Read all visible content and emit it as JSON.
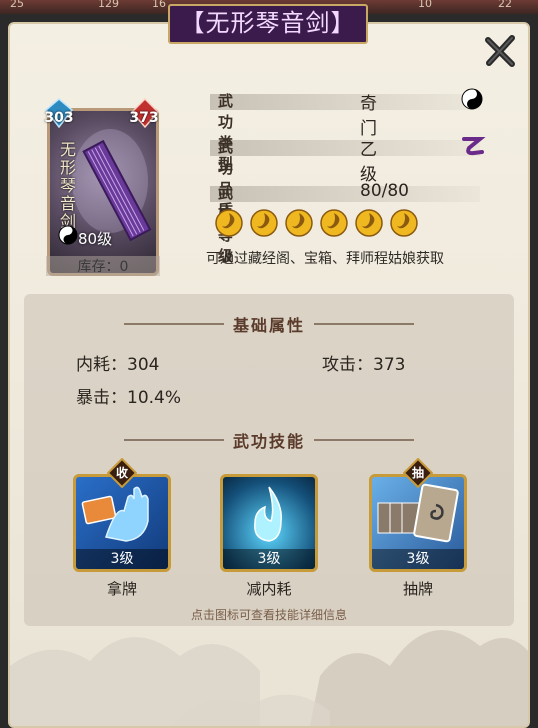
{
  "top_strip": {
    "numbers": [
      "25",
      "129",
      "16",
      "10",
      "22"
    ]
  },
  "title": "【无形琴音剑】",
  "card": {
    "name_vertical": "无形琴音剑",
    "left_gem_value": "303",
    "right_gem_value": "373",
    "level": "80级",
    "stock": "库存：0"
  },
  "info": {
    "type_label": "武功类型",
    "type_value": "奇门",
    "quality_label": "武功品质",
    "quality_value": "乙级",
    "level_label": "武功等级",
    "level_value": "80/80",
    "stars_filled": 6,
    "source": "可通过藏经阁、宝箱、拜师程姑娘获取"
  },
  "basic_attributes": {
    "heading": "基础属性",
    "neihao": "内耗：304",
    "attack": "攻击：373",
    "crit": "暴击：10.4%"
  },
  "skills_section": {
    "heading": "武功技能",
    "skills": [
      {
        "name": "拿牌",
        "level": "3级",
        "badge": "收",
        "icon": "card-hand-icon"
      },
      {
        "name": "减内耗",
        "level": "3级",
        "badge": "",
        "icon": "blue-flame-icon"
      },
      {
        "name": "抽牌",
        "level": "3级",
        "badge": "抽",
        "icon": "card-draw-icon"
      }
    ],
    "hint": "点击图标可查看技能详细信息"
  },
  "colors": {
    "title_bg": "#3b1b4c",
    "gold": "#c79a3a",
    "purple_quality": "#6a2a8a"
  }
}
